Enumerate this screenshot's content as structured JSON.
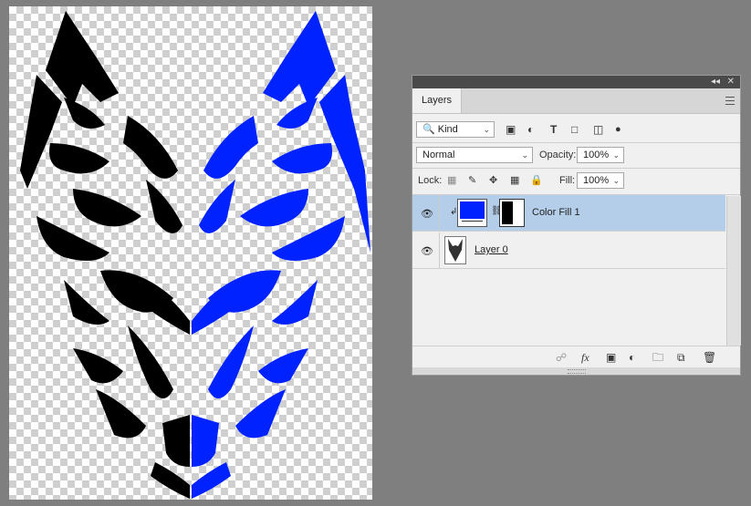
{
  "colors": {
    "fill_blue": "#0022ff",
    "selected_row": "#b4cde8",
    "app_bg": "#7f7f7f"
  },
  "panel": {
    "title_tab": "Layers",
    "filter": {
      "kind_label": "Kind",
      "icons": [
        "image-filter-icon",
        "adjustment-filter-icon",
        "type-filter-icon",
        "shape-filter-icon",
        "smart-object-filter-icon",
        "filter-toggle-icon"
      ]
    },
    "blend": {
      "mode": "Normal",
      "opacity_label": "Opacity:",
      "opacity_value": "100%"
    },
    "lock": {
      "label": "Lock:",
      "fill_label": "Fill:",
      "fill_value": "100%"
    },
    "layers": [
      {
        "name": "Color Fill 1",
        "selected": true
      },
      {
        "name": "Layer 0",
        "selected": false
      }
    ],
    "bottom_icons": [
      "link-icon",
      "fx-icon",
      "mask-icon",
      "adjustment-icon",
      "folder-icon",
      "new-layer-icon",
      "trash-icon"
    ]
  }
}
